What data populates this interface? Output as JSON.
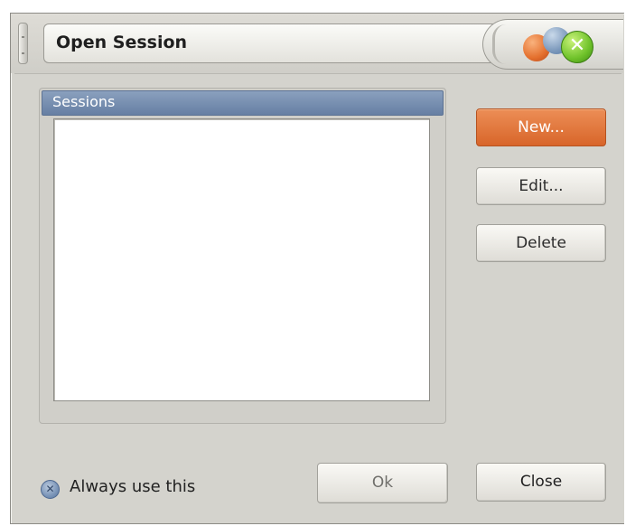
{
  "window": {
    "title": "Open Session"
  },
  "title_controls": {
    "close_glyph": "✕",
    "icons": [
      "minimize-orb-icon",
      "maximize-orb-icon",
      "close-icon"
    ],
    "colors": {
      "orange": "#e46f2d",
      "blue": "#7c99bc",
      "green": "#6fc22a"
    }
  },
  "sessions": {
    "header_label": "Sessions",
    "items": []
  },
  "buttons": {
    "new_label": "New...",
    "edit_label": "Edit...",
    "delete_label": "Delete",
    "ok_label": "Ok",
    "close_label": "Close"
  },
  "always_use": {
    "label": "Always use this",
    "checked": true,
    "mark_glyph": "✕"
  },
  "colors": {
    "accent_button": "#d8652a",
    "list_header": "#667fa3",
    "dialog_background": "#d4d3cd"
  }
}
